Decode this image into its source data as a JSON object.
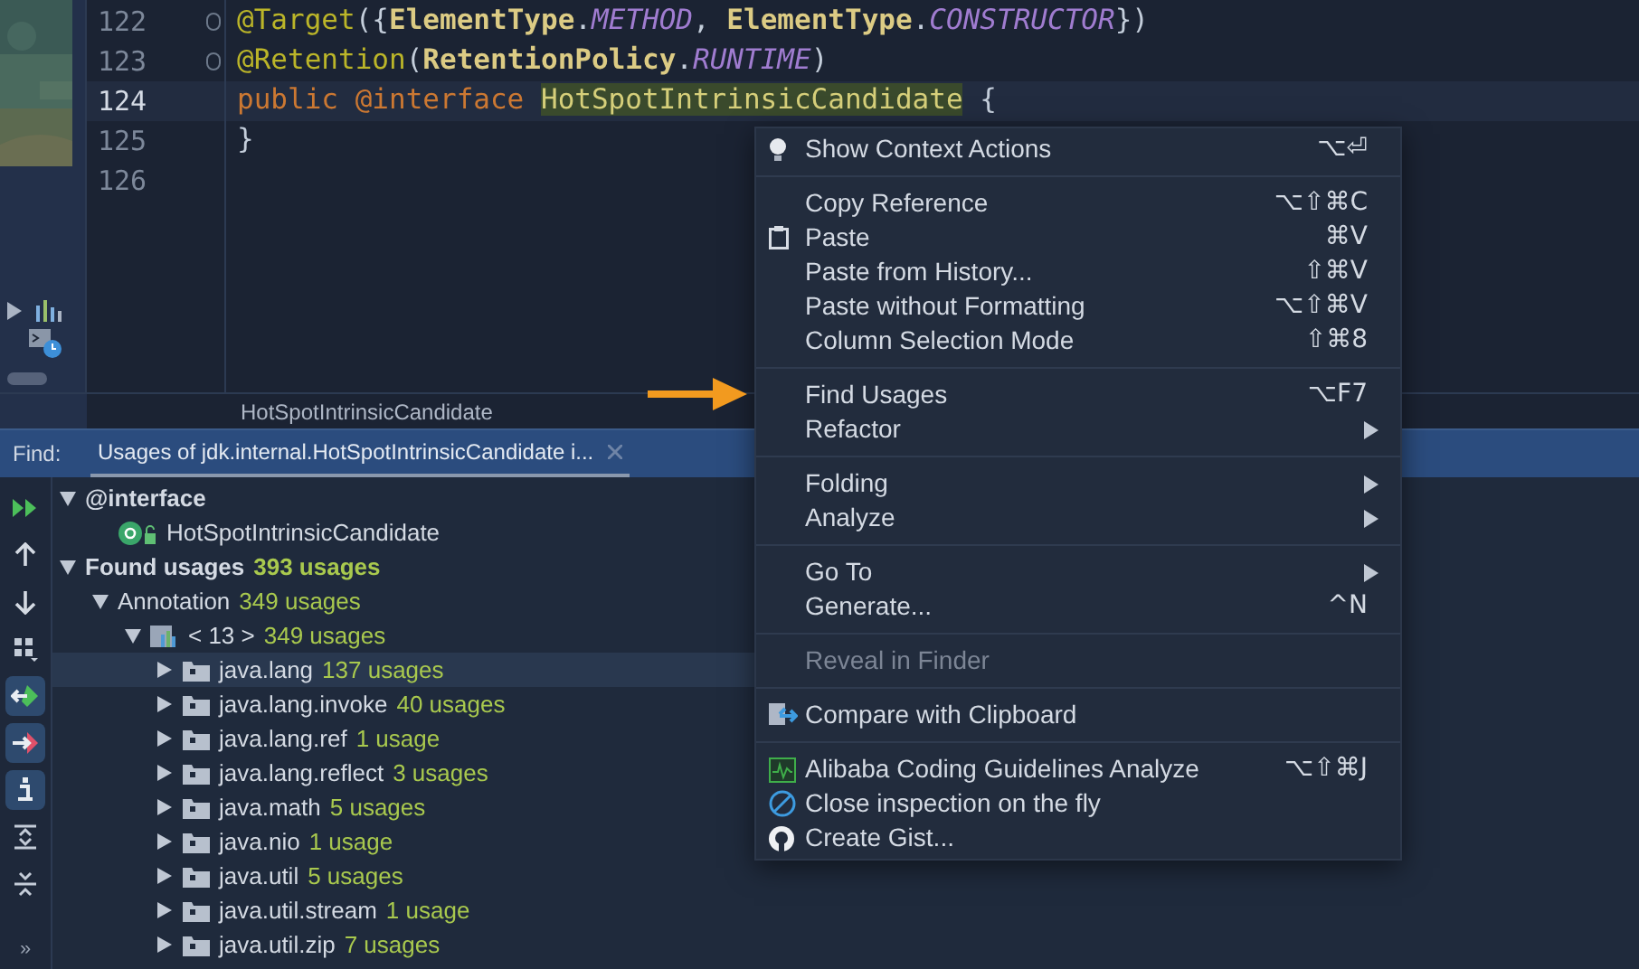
{
  "editor": {
    "lines": [
      {
        "number": "122",
        "current": false,
        "fold_marker": true,
        "tokens": [
          {
            "kind": "annotation",
            "text": "@Target"
          },
          {
            "kind": "punct",
            "text": "({"
          },
          {
            "kind": "type",
            "text": "ElementType"
          },
          {
            "kind": "punct",
            "text": "."
          },
          {
            "kind": "constant",
            "text": "METHOD"
          },
          {
            "kind": "punct",
            "text": ", "
          },
          {
            "kind": "type",
            "text": "ElementType"
          },
          {
            "kind": "punct",
            "text": "."
          },
          {
            "kind": "constant",
            "text": "CONSTRUCTOR"
          },
          {
            "kind": "punct",
            "text": "})"
          }
        ]
      },
      {
        "number": "123",
        "current": false,
        "fold_marker": true,
        "tokens": [
          {
            "kind": "annotation",
            "text": "@Retention"
          },
          {
            "kind": "punct",
            "text": "("
          },
          {
            "kind": "type",
            "text": "RetentionPolicy"
          },
          {
            "kind": "punct",
            "text": "."
          },
          {
            "kind": "constant",
            "text": "RUNTIME"
          },
          {
            "kind": "punct",
            "text": ")"
          }
        ]
      },
      {
        "number": "124",
        "current": true,
        "fold_marker": false,
        "tokens": [
          {
            "kind": "keyword",
            "text": "public @interface "
          },
          {
            "kind": "highlight",
            "text": "HotSpotIntrinsicCandidate"
          },
          {
            "kind": "punct",
            "text": " {"
          }
        ]
      },
      {
        "number": "125",
        "current": false,
        "fold_marker": false,
        "tokens": [
          {
            "kind": "punct",
            "text": "}"
          }
        ]
      },
      {
        "number": "126",
        "current": false,
        "fold_marker": false
      }
    ],
    "breadcrumb": "HotSpotIntrinsicCandidate"
  },
  "context_menu": {
    "groups": [
      [
        {
          "kind": "bulb",
          "label": "Show Context Actions",
          "shortcut": "⌥⏎",
          "submenu": false,
          "disabled": false
        }
      ],
      [
        {
          "kind": "plain",
          "label": "Copy Reference",
          "shortcut": "⌥⇧⌘C",
          "submenu": false,
          "disabled": false
        },
        {
          "kind": "clipboard",
          "label": "Paste",
          "shortcut": "⌘V",
          "submenu": false,
          "disabled": false
        },
        {
          "kind": "plain",
          "label": "Paste from History...",
          "shortcut": "⇧⌘V",
          "submenu": false,
          "disabled": false
        },
        {
          "kind": "plain",
          "label": "Paste without Formatting",
          "shortcut": "⌥⇧⌘V",
          "submenu": false,
          "disabled": false
        },
        {
          "kind": "plain",
          "label": "Column Selection Mode",
          "shortcut": "⇧⌘8",
          "submenu": false,
          "disabled": false
        }
      ],
      [
        {
          "kind": "plain",
          "label": "Find Usages",
          "shortcut": "⌥F7",
          "submenu": false,
          "disabled": false
        },
        {
          "kind": "plain",
          "label": "Refactor",
          "submenu": true,
          "disabled": false
        }
      ],
      [
        {
          "kind": "plain",
          "label": "Folding",
          "submenu": true,
          "disabled": false
        },
        {
          "kind": "plain",
          "label": "Analyze",
          "submenu": true,
          "disabled": false
        }
      ],
      [
        {
          "kind": "plain",
          "label": "Go To",
          "submenu": true,
          "disabled": false
        },
        {
          "kind": "plain",
          "label": "Generate...",
          "shortcut": "^N",
          "submenu": false,
          "disabled": false
        }
      ],
      [
        {
          "kind": "plain",
          "label": "Reveal in Finder",
          "submenu": false,
          "disabled": true
        }
      ],
      [
        {
          "kind": "compare",
          "label": "Compare with Clipboard",
          "submenu": false,
          "disabled": false
        }
      ],
      [
        {
          "kind": "inspect",
          "label": "Alibaba Coding Guidelines Analyze",
          "shortcut": "⌥⇧⌘J",
          "submenu": false,
          "disabled": false
        },
        {
          "kind": "forbid",
          "label": "Close inspection on the fly",
          "submenu": false,
          "disabled": false
        },
        {
          "kind": "github",
          "label": "Create Gist...",
          "submenu": false,
          "disabled": false
        }
      ]
    ]
  },
  "find_panel": {
    "label": "Find:",
    "tab": "Usages of jdk.internal.HotSpotIntrinsicCandidate i...",
    "toolbar": [
      {
        "kind": "rerun",
        "on": false
      },
      {
        "kind": "up",
        "on": false
      },
      {
        "kind": "down",
        "on": false
      },
      {
        "kind": "group",
        "on": false
      },
      {
        "kind": "import",
        "on": true
      },
      {
        "kind": "export",
        "on": true
      },
      {
        "kind": "info",
        "on": true
      },
      {
        "kind": "expand",
        "on": false
      },
      {
        "kind": "collapse",
        "on": false
      },
      {
        "kind": "more",
        "label": "»",
        "on": false
      }
    ],
    "tree": [
      {
        "label": "@interface",
        "bold": true,
        "expanded": true,
        "selected": false,
        "children": [
          {
            "kind": "annotation",
            "label": "HotSpotIntrinsicCandidate",
            "bold": false,
            "selected": false
          }
        ]
      },
      {
        "label": "Found usages",
        "count": "393 usages",
        "bold": true,
        "expanded": true,
        "selected": false,
        "children": [
          {
            "label": "Annotation",
            "count": "349 usages",
            "bold": false,
            "expanded": true,
            "selected": false,
            "children": [
              {
                "kind": "module",
                "label": "< 13 >",
                "count": "349 usages",
                "bold": false,
                "expanded": true,
                "selected": false,
                "children": [
                  {
                    "kind": "package",
                    "label": "java.lang",
                    "count": "137 usages",
                    "bold": false,
                    "expanded": false,
                    "selected": true
                  },
                  {
                    "kind": "package",
                    "label": "java.lang.invoke",
                    "count": "40 usages",
                    "bold": false,
                    "expanded": false,
                    "selected": false
                  },
                  {
                    "kind": "package",
                    "label": "java.lang.ref",
                    "count": "1 usage",
                    "bold": false,
                    "expanded": false,
                    "selected": false
                  },
                  {
                    "kind": "package",
                    "label": "java.lang.reflect",
                    "count": "3 usages",
                    "bold": false,
                    "expanded": false,
                    "selected": false
                  },
                  {
                    "kind": "package",
                    "label": "java.math",
                    "count": "5 usages",
                    "bold": false,
                    "expanded": false,
                    "selected": false
                  },
                  {
                    "kind": "package",
                    "label": "java.nio",
                    "count": "1 usage",
                    "bold": false,
                    "expanded": false,
                    "selected": false
                  },
                  {
                    "kind": "package",
                    "label": "java.util",
                    "count": "5 usages",
                    "bold": false,
                    "expanded": false,
                    "selected": false
                  },
                  {
                    "kind": "package",
                    "label": "java.util.stream",
                    "count": "1 usage",
                    "bold": false,
                    "expanded": false,
                    "selected": false
                  },
                  {
                    "kind": "package",
                    "label": "java.util.zip",
                    "count": "7 usages",
                    "bold": false,
                    "expanded": false,
                    "selected": false
                  }
                ]
              }
            ]
          }
        ]
      }
    ]
  }
}
